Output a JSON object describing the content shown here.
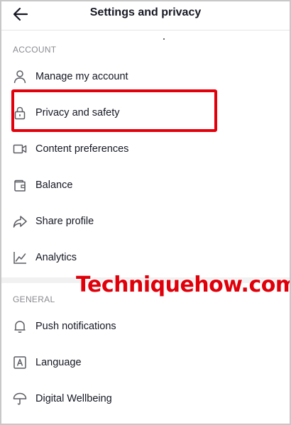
{
  "header": {
    "title": "Settings and privacy",
    "back_icon": "arrow-left-icon"
  },
  "sections": [
    {
      "label": "ACCOUNT",
      "items": [
        {
          "label": "Manage my account",
          "icon": "person-icon"
        },
        {
          "label": "Privacy and safety",
          "icon": "lock-icon"
        },
        {
          "label": "Content preferences",
          "icon": "video-icon"
        },
        {
          "label": "Balance",
          "icon": "wallet-icon"
        },
        {
          "label": "Share profile",
          "icon": "share-icon"
        },
        {
          "label": "Analytics",
          "icon": "analytics-icon"
        }
      ]
    },
    {
      "label": "GENERAL",
      "items": [
        {
          "label": "Push notifications",
          "icon": "bell-icon"
        },
        {
          "label": "Language",
          "icon": "language-icon"
        },
        {
          "label": "Digital Wellbeing",
          "icon": "umbrella-icon"
        }
      ]
    }
  ],
  "watermark": "Techniquehow.com",
  "colors": {
    "highlight": "#e3000b",
    "text": "#161823",
    "section_label": "#8a8b91",
    "icon": "#5c5d63"
  }
}
